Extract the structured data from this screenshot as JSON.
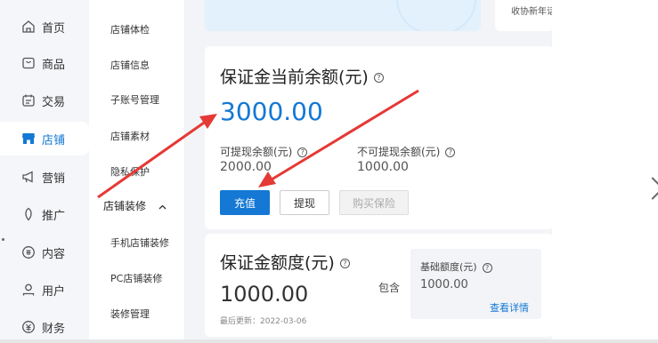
{
  "nav": {
    "items": [
      {
        "label": "首页",
        "icon": "home-icon"
      },
      {
        "label": "商品",
        "icon": "product-icon"
      },
      {
        "label": "交易",
        "icon": "trade-icon"
      },
      {
        "label": "店铺",
        "icon": "store-icon"
      },
      {
        "label": "营销",
        "icon": "megaphone-icon"
      },
      {
        "label": "推广",
        "icon": "promote-icon"
      },
      {
        "label": "内容",
        "icon": "content-icon"
      },
      {
        "label": "用户",
        "icon": "user-icon"
      },
      {
        "label": "财务",
        "icon": "finance-icon"
      }
    ],
    "active": "店铺"
  },
  "submenu": {
    "items": [
      "店铺体检",
      "店铺信息",
      "子账号管理",
      "店铺素材",
      "隐私保护"
    ],
    "group": {
      "label": "店铺装修",
      "items": [
        "手机店铺装修",
        "PC店铺装修",
        "装修管理"
      ]
    }
  },
  "top": {
    "right_text": "收协新年话"
  },
  "deposit": {
    "title": "保证金当前余额(元)",
    "amount": "3000.00",
    "withdrawable_label": "可提现余额(元)",
    "withdrawable_value": "2000.00",
    "non_withdrawable_label": "不可提现余额(元)",
    "non_withdrawable_value": "1000.00",
    "recharge_button": "充值",
    "withdraw_button": "提现",
    "buy_insurance_button": "购买保险"
  },
  "quota": {
    "title": "保证金额度(元)",
    "amount": "1000.00",
    "last_updated": "最后更新：2022-03-06",
    "includes_label": "包含",
    "base_label": "基础额度(元)",
    "base_value": "1000.00",
    "details_link": "查看详情"
  },
  "colors": {
    "accent": "#1478d4",
    "arrow": "#e53935"
  }
}
